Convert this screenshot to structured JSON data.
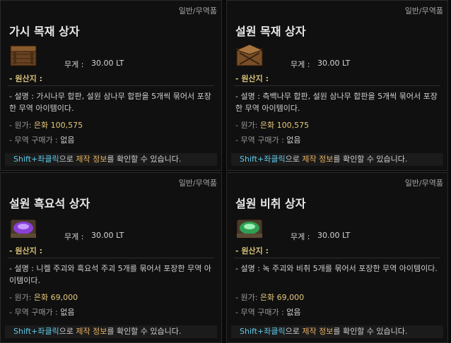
{
  "cards": [
    {
      "category": "일반/무역품",
      "title": "가시 목재 상자",
      "weight_label": "무게 :",
      "weight_value": "30.00 LT",
      "origin_label": "- 원산지 :",
      "description": "- 설명 : 가시나무 합판, 설원 삼나무 합판을 5개씩 묶어서 포장한 무역 아이템이다.",
      "price_label": "- 원가:",
      "price_value": "은화 100,575",
      "trade_label": "- 무역 구매가 :",
      "trade_value": "없음",
      "icon": "wooden-crate-icon",
      "icon_color": "#8a5a2b"
    },
    {
      "category": "일반/무역품",
      "title": "설원 목재 상자",
      "weight_label": "무게 :",
      "weight_value": "30.00 LT",
      "origin_label": "- 원산지 :",
      "description": "- 설명 : 측백나무 합판, 설원 삼나무 합판을 5개씩 묶어서 포장한 무역 아이템이다.",
      "price_label": "- 원가:",
      "price_value": "은화 100,575",
      "trade_label": "- 무역 구매가 :",
      "trade_value": "없음",
      "icon": "wooden-crate-icon",
      "icon_color": "#9a6a36"
    },
    {
      "category": "일반/무역품",
      "title": "설원 흑요석 상자",
      "weight_label": "무게 :",
      "weight_value": "30.00 LT",
      "origin_label": "- 원산지 :",
      "description": "- 설명 : 니켈 주괴와 흑요석 주괴 5개를 묶어서 포장한 무역 아이템이다.",
      "price_label": "- 원가:",
      "price_value": "은화 69,000",
      "trade_label": "- 무역 구매가 :",
      "trade_value": "없음",
      "icon": "obsidian-chest-icon",
      "icon_color": "#8a3fd6"
    },
    {
      "category": "일반/무역품",
      "title": "설원 비취 상자",
      "weight_label": "무게 :",
      "weight_value": "30.00 LT",
      "origin_label": "- 원산지 :",
      "description": "- 설명 : 녹 주괴와 비취 5개를 묶어서 포장한 무역 아이템이다.",
      "price_label": "- 원가:",
      "price_value": "은화 69,000",
      "trade_label": "- 무역 구매가 :",
      "trade_value": "없음",
      "icon": "jade-chest-icon",
      "icon_color": "#3fcf6a"
    }
  ],
  "footer": {
    "part1": "Shift+좌클릭",
    "part2": "으로 ",
    "part3": "제작 정보",
    "part4": "를 확인할 수 있습니다."
  }
}
